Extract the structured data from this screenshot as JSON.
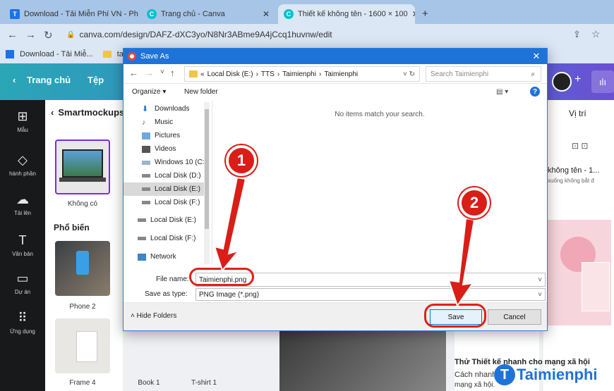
{
  "browser": {
    "tabs": [
      {
        "label": "Download - Tải Miễn Phí VN - Ph"
      },
      {
        "label": "Trang chủ - Canva"
      },
      {
        "label": "Thiết kế không tên - 1600 × 100"
      }
    ],
    "new_tab": "+",
    "url": "canva.com/design/DAFZ-dXC3yo/N8Nr3ABme9A4jCcq1huvnw/edit",
    "bookmarks": [
      "Download - Tải Miễ...",
      "taim"
    ]
  },
  "canva": {
    "home": "Trang chủ",
    "file": "Tệp",
    "rail": [
      {
        "icon": "template-icon",
        "label": "Mẫu"
      },
      {
        "icon": "elements-icon",
        "label": "hành phần"
      },
      {
        "icon": "upload-icon",
        "label": "Tải lên"
      },
      {
        "icon": "text-icon",
        "label": "Văn bản"
      },
      {
        "icon": "folder-icon",
        "label": "Dự án"
      },
      {
        "icon": "apps-icon",
        "label": "Ứng dụng"
      }
    ],
    "panel_title": "Smartmockups",
    "none_label": "Không có",
    "popular": "Phổ biến",
    "mockups": [
      "Phone 2",
      "Frame 4",
      "Book 1",
      "T-shirt 1"
    ],
    "position": "Vị trí",
    "design_title": "không tên - 1...",
    "design_sub": "xuống không bắt đ",
    "promo": "Thử Thiết kế nhanh cho mạng xã hội",
    "promo_sub": "Cách nhanh",
    "promo_sub2": "mạng xã hội."
  },
  "dialog": {
    "title": "Save As",
    "path": [
      "Local Disk (E:)",
      "TTS",
      "Taimienphi",
      "Taimienphi"
    ],
    "search_placeholder": "Search Taimienphi",
    "organize": "Organize ▾",
    "new_folder": "New folder",
    "tree": [
      {
        "icon": "download-icon",
        "label": "Downloads"
      },
      {
        "icon": "music-icon",
        "label": "Music"
      },
      {
        "icon": "pictures-icon",
        "label": "Pictures"
      },
      {
        "icon": "videos-icon",
        "label": "Videos"
      },
      {
        "icon": "drive-icon",
        "label": "Windows 10 (C:)"
      },
      {
        "icon": "drive-icon",
        "label": "Local Disk (D:)"
      },
      {
        "icon": "drive-icon",
        "label": "Local Disk (E:)"
      },
      {
        "icon": "drive-icon",
        "label": "Local Disk (F:)"
      },
      {
        "icon": "drive-icon",
        "label": "Local Disk (E:)"
      },
      {
        "icon": "drive-icon",
        "label": "Local Disk (F:)"
      },
      {
        "icon": "network-icon",
        "label": "Network"
      }
    ],
    "empty_message": "No items match your search.",
    "file_name_label": "File name:",
    "file_name_value": "Taimienphi.png",
    "save_type_label": "Save as type:",
    "save_type_value": "PNG Image (*.png)",
    "hide_folders": "Hide Folders",
    "save": "Save",
    "cancel": "Cancel"
  },
  "annotations": {
    "step1": "1",
    "step2": "2"
  },
  "watermark": "Taimienphi",
  "colors": {
    "accent": "#1e73d8",
    "annotation_red": "#d91e18",
    "canva_dark": "#18191b"
  }
}
